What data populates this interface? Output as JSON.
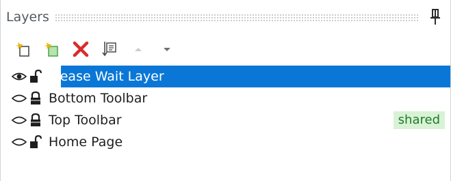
{
  "panel": {
    "title": "Layers"
  },
  "toolbar": {
    "buttons": [
      {
        "icon": "new-layer-icon",
        "tooltip": ""
      },
      {
        "icon": "new-shared-layer-icon",
        "tooltip": ""
      },
      {
        "icon": "delete-icon",
        "tooltip": ""
      },
      {
        "icon": "layer-properties-icon",
        "tooltip": ""
      },
      {
        "icon": "move-up-icon",
        "tooltip": ""
      },
      {
        "icon": "move-down-icon",
        "tooltip": ""
      }
    ]
  },
  "layers": [
    {
      "name": "Please Wait Layer",
      "visible": true,
      "locked": false,
      "selected": true,
      "badge": ""
    },
    {
      "name": "Bottom Toolbar",
      "visible": false,
      "locked": true,
      "selected": false,
      "badge": ""
    },
    {
      "name": "Top Toolbar",
      "visible": false,
      "locked": true,
      "selected": false,
      "badge": "shared"
    },
    {
      "name": "Home Page",
      "visible": false,
      "locked": false,
      "selected": false,
      "badge": ""
    }
  ],
  "colors": {
    "selection": "#0a77d6",
    "shared_badge_bg": "#d9f2d5",
    "shared_badge_text": "#1f7a2a",
    "delete_red": "#d82c2c",
    "new_layer_yellow": "#e8b40a",
    "new_shared_green": "#4fa84a"
  }
}
